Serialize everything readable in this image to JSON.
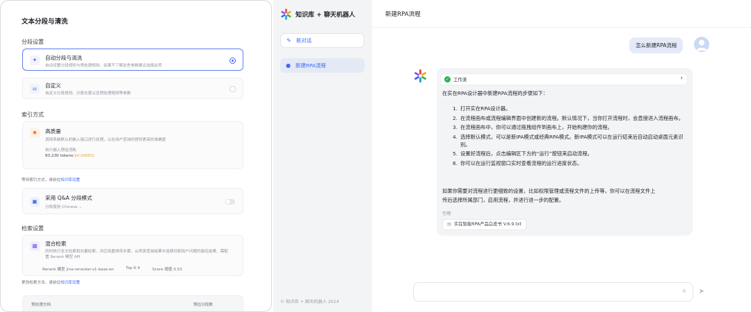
{
  "settings": {
    "title": "文本分段与清洗",
    "seg_heading": "分段设置",
    "auto": {
      "label": "自动分段与清洗",
      "desc": "自动设置分段规则与预处理规则，如果不了解这些参数建议选择此项"
    },
    "custom": {
      "label": "自定义",
      "desc": "自定义分段规则、分段长度以及预处理规则等参数"
    },
    "index_heading": "索引方式",
    "hq": {
      "label": "高质量",
      "desc": "调用系统默认的嵌入接口进行处理，以在用户查询时提供更高的准确度",
      "cost_label": "执行嵌入预估消耗",
      "cost_tokens": "83,230 tokens",
      "cost_price": "($0.00083)"
    },
    "index_note": "等待索引方式，请前往",
    "index_note_link": "知识库设置",
    "qa": {
      "label": "采用 Q&A 分段模式",
      "lang": "分段使用 Chinese"
    },
    "retrieval_heading": "检索设置",
    "hybrid": {
      "label": "混合检索",
      "desc1": "同时执行全文检索和向量检索，并应用重排序步骤，从两类查询结果中选择匹配用户问题的最佳结果，需配",
      "desc2": "置 Rerank 模型 API",
      "rerank": "Rerank 模型 jina-reranker-v1-base-en",
      "topk": "Top K 4",
      "score": "Score 阈值 0.53"
    },
    "retrieval_note": "更改检索方法，请前往",
    "retrieval_note_link": "知识库设置",
    "preview_left": "预处理文档",
    "preview_right": "预估分段数"
  },
  "sidebar": {
    "app_name": "知识库 + 聊天机器人",
    "new_chat": "新对话",
    "active_item": "新建RPA流程",
    "footer": "© 知识库 + 聊天机器人 2024"
  },
  "chat": {
    "title": "新建RPA流程",
    "user_message": "怎么新建RPA流程",
    "workflow_label": "工作流",
    "intro": "在实在RPA设计器中新建RPA流程的步骤如下：",
    "steps": [
      {
        "n": "1.",
        "text": "打开实在RPA设计器。"
      },
      {
        "n": "2.",
        "text": "在流程画布或流程编辑界面中创建新的流程。默认情况下，当你打开流程时，会直接进入流程画布。"
      },
      {
        "n": "3.",
        "text": "在流程画布中，你可以通过拖拽组件到画布上，开始构建你的流程。"
      },
      {
        "n": "4.",
        "text": "选择默认模式，可以是新IPA模式或经典RPA模式。新IPA模式可以在运行结束后自动启动桌面元素识别。"
      },
      {
        "n": "5.",
        "text": "设置好流程后，点击编辑区下方的“运行”按钮来启动流程。"
      },
      {
        "n": "6.",
        "text": "你可以在运行监视窗口实时查看流程的运行进度状态。"
      }
    ],
    "outro1": "如果你需要对流程进行更细致的设置，比如权限管理或流程文件的上传等，你可以在流程文件上",
    "outro2": "传后选择所属部门，启用流程，并进行进一步的配置。",
    "cite_label": "引用",
    "cite_file": "实在智能RPA产品白皮书 V.6.9.txt",
    "input_count": "0"
  },
  "colors": {
    "accent": "#3d6af2",
    "success": "#22b45a",
    "price": "#e8a33a",
    "bot_bubble": "#f3f4f6",
    "user_bubble": "#e4eaf7"
  }
}
